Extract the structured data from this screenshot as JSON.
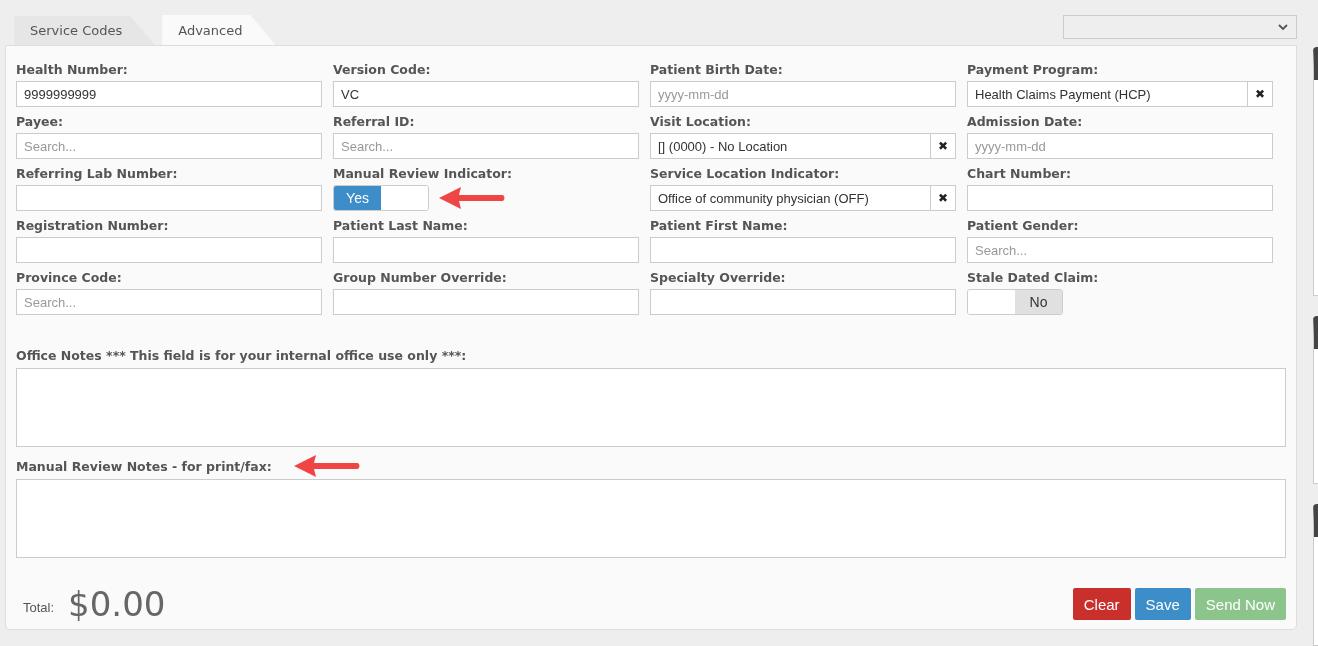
{
  "tabs": [
    {
      "label": "Service Codes",
      "selected": false
    },
    {
      "label": "Advanced",
      "selected": true
    }
  ],
  "fields": [
    {
      "label": "Health Number:",
      "kind": "text",
      "value": "9999999999"
    },
    {
      "label": "Version Code:",
      "kind": "text",
      "value": "VC"
    },
    {
      "label": "Patient Birth Date:",
      "kind": "text",
      "placeholder": "yyyy-mm-dd"
    },
    {
      "label": "Payment Program:",
      "kind": "clearable",
      "value": "Health Claims Payment (HCP)",
      "clear": "✖"
    },
    {
      "label": "Payee:",
      "kind": "text",
      "placeholder": "Search..."
    },
    {
      "label": "Referral ID:",
      "kind": "text",
      "placeholder": "Search..."
    },
    {
      "label": "Visit Location:",
      "kind": "clearable",
      "value": "[]  (0000) - No Location",
      "clear": "✖"
    },
    {
      "label": "Admission Date:",
      "kind": "text",
      "placeholder": "yyyy-mm-dd"
    },
    {
      "label": "Referring Lab Number:",
      "kind": "text"
    },
    {
      "label": "Manual Review Indicator:",
      "kind": "toggle",
      "on": true,
      "text": "Yes",
      "annotated": true
    },
    {
      "label": "Service Location Indicator:",
      "kind": "clearable",
      "value": "Office of community physician (OFF)",
      "clear": "✖"
    },
    {
      "label": "Chart Number:",
      "kind": "text"
    },
    {
      "label": "Registration Number:",
      "kind": "text"
    },
    {
      "label": "Patient Last Name:",
      "kind": "text"
    },
    {
      "label": "Patient First Name:",
      "kind": "text"
    },
    {
      "label": "Patient Gender:",
      "kind": "text",
      "placeholder": "Search..."
    },
    {
      "label": "Province Code:",
      "kind": "text",
      "placeholder": "Search..."
    },
    {
      "label": "Group Number Override:",
      "kind": "text"
    },
    {
      "label": "Specialty Override:",
      "kind": "text"
    },
    {
      "label": "Stale Dated Claim:",
      "kind": "toggle",
      "on": false,
      "text": "No"
    }
  ],
  "notes": [
    {
      "label": "Office Notes *** This field is for your internal office use only ***:",
      "annotated": false
    },
    {
      "label": "Manual Review Notes - for print/fax:",
      "annotated": true
    }
  ],
  "total": {
    "label": "Total:",
    "amount": "$0.00"
  },
  "buttons": [
    {
      "label": "Clear",
      "kind": "danger"
    },
    {
      "label": "Save",
      "kind": "primary"
    },
    {
      "label": "Send Now",
      "kind": "success",
      "disabled": true
    }
  ]
}
